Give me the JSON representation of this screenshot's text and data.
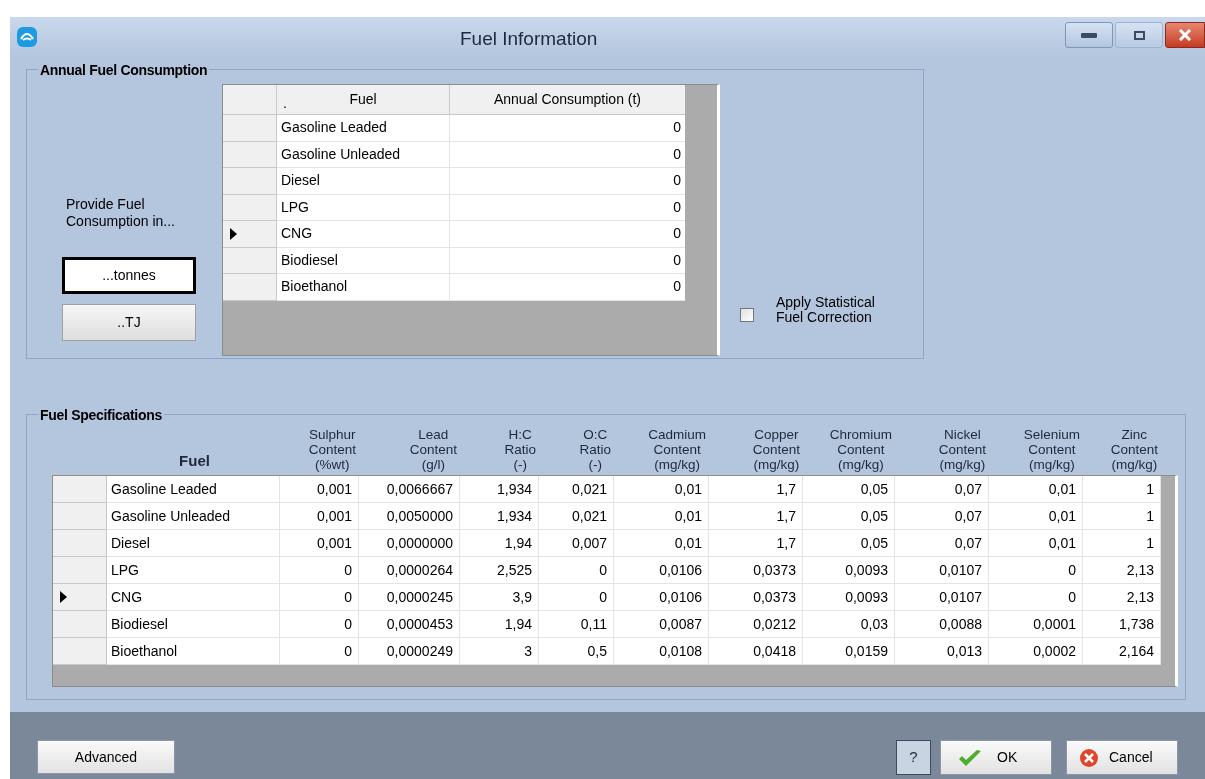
{
  "window": {
    "title": "Fuel Information"
  },
  "consumption": {
    "title": "Annual Fuel Consumption",
    "prompt": "Provide Fuel Consumption in...",
    "unit_buttons": [
      {
        "label": "...tonnes",
        "selected": true
      },
      {
        "label": "..TJ",
        "selected": false
      }
    ],
    "columns": [
      {
        "label": "Fuel",
        "sort_mark": "."
      },
      {
        "label": "Annual Consumption (t)"
      }
    ],
    "rows": [
      {
        "fuel": "Gasoline Leaded",
        "value": "0",
        "selected": false
      },
      {
        "fuel": "Gasoline Unleaded",
        "value": "0",
        "selected": false
      },
      {
        "fuel": "Diesel",
        "value": "0",
        "selected": false
      },
      {
        "fuel": "LPG",
        "value": "0",
        "selected": false
      },
      {
        "fuel": "CNG",
        "value": "0",
        "selected": true
      },
      {
        "fuel": "Biodiesel",
        "value": "0",
        "selected": false
      },
      {
        "fuel": "Bioethanol",
        "value": "0",
        "selected": false
      }
    ],
    "correction": {
      "label": "Apply Statistical Fuel Correction",
      "checked": false
    }
  },
  "specifications": {
    "title": "Fuel Specifications",
    "columns": [
      [
        "Fuel"
      ],
      [
        "Sulphur",
        "Content",
        "(%wt)"
      ],
      [
        "Lead",
        "Content",
        "(g/l)"
      ],
      [
        "H:C",
        "Ratio",
        "(-)"
      ],
      [
        "O:C",
        "Ratio",
        "(-)"
      ],
      [
        "Cadmium",
        "Content",
        "(mg/kg)"
      ],
      [
        "Copper",
        "Content",
        "(mg/kg)"
      ],
      [
        "Chromium",
        "Content",
        "(mg/kg)"
      ],
      [
        "Nickel",
        "Content",
        "(mg/kg)"
      ],
      [
        "Selenium",
        "Content",
        "(mg/kg)"
      ],
      [
        "Zinc",
        "Content",
        "(mg/kg)"
      ]
    ],
    "rows": [
      {
        "selected": false,
        "fuel": "Gasoline Leaded",
        "values": [
          "0,001",
          "0,0066667",
          "1,934",
          "0,021",
          "0,01",
          "1,7",
          "0,05",
          "0,07",
          "0,01",
          "1"
        ]
      },
      {
        "selected": false,
        "fuel": "Gasoline Unleaded",
        "values": [
          "0,001",
          "0,0050000",
          "1,934",
          "0,021",
          "0,01",
          "1,7",
          "0,05",
          "0,07",
          "0,01",
          "1"
        ]
      },
      {
        "selected": false,
        "fuel": "Diesel",
        "values": [
          "0,001",
          "0,0000000",
          "1,94",
          "0,007",
          "0,01",
          "1,7",
          "0,05",
          "0,07",
          "0,01",
          "1"
        ]
      },
      {
        "selected": false,
        "fuel": "LPG",
        "values": [
          "0",
          "0,0000264",
          "2,525",
          "0",
          "0,0106",
          "0,0373",
          "0,0093",
          "0,0107",
          "0",
          "2,13"
        ]
      },
      {
        "selected": true,
        "fuel": "CNG",
        "values": [
          "0",
          "0,0000245",
          "3,9",
          "0",
          "0,0106",
          "0,0373",
          "0,0093",
          "0,0107",
          "0",
          "2,13"
        ]
      },
      {
        "selected": false,
        "fuel": "Biodiesel",
        "values": [
          "0",
          "0,0000453",
          "1,94",
          "0,11",
          "0,0087",
          "0,0212",
          "0,03",
          "0,0088",
          "0,0001",
          "1,738"
        ]
      },
      {
        "selected": false,
        "fuel": "Bioethanol",
        "values": [
          "0",
          "0,0000249",
          "3",
          "0,5",
          "0,0108",
          "0,0418",
          "0,0159",
          "0,013",
          "0,0002",
          "2,164"
        ]
      }
    ]
  },
  "buttons": {
    "advanced": "Advanced",
    "help": "?",
    "ok": "OK",
    "cancel": "Cancel"
  }
}
